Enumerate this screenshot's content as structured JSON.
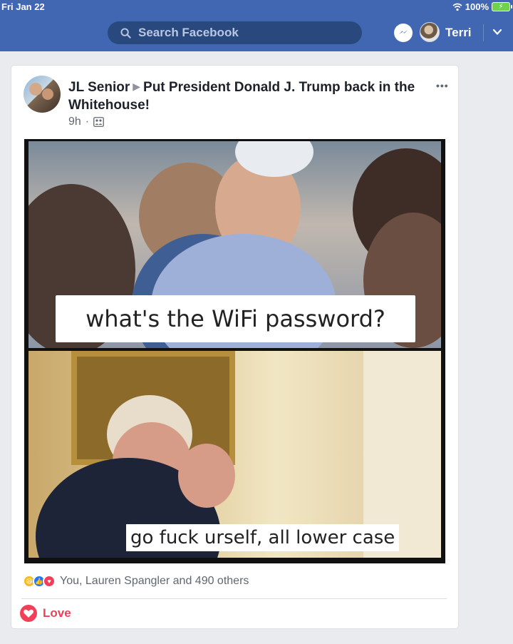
{
  "status_bar": {
    "time": "Fri Jan 22",
    "battery": "100%"
  },
  "header": {
    "search_placeholder": "Search Facebook",
    "profile_name": "Terri"
  },
  "post": {
    "author": "JL Senior",
    "target_group": "Put President Donald J. Trump back in the Whitehouse!",
    "time": "9h",
    "separator": "·",
    "meme": {
      "top_caption": "what's the WiFi password?",
      "bottom_caption": "go fuck urself, all lower case"
    },
    "reactions_text": "You, Lauren Spangler and 490 others",
    "action_label": "Love"
  },
  "colors": {
    "brand": "#4267b2",
    "love": "#f33e58",
    "like": "#2078f4",
    "haha": "#f7b928"
  },
  "icons": [
    "wifi-icon",
    "battery-icon",
    "search-icon",
    "messenger-icon",
    "chevron-down-icon",
    "more-icon",
    "group-icon",
    "love-icon"
  ]
}
